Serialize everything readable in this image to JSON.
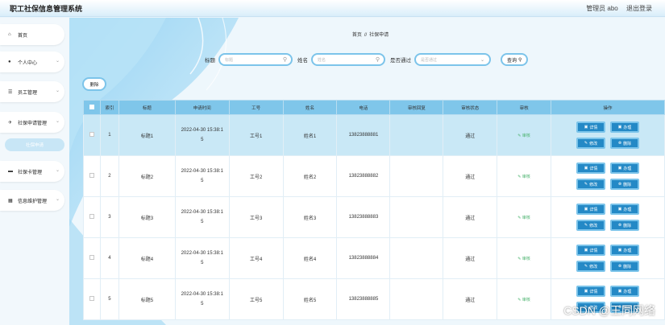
{
  "header": {
    "title": "职工社保信息管理系统",
    "user_label": "管理员 abo",
    "logout_label": "退出登录"
  },
  "sidebar": {
    "items": [
      {
        "label": "首页",
        "icon": "home-icon",
        "glyph": "⌂"
      },
      {
        "label": "个人中心",
        "icon": "user-icon",
        "glyph": "●"
      },
      {
        "label": "员工管理",
        "icon": "list-icon",
        "glyph": "☰"
      },
      {
        "label": "社保申请管理",
        "icon": "pin-icon",
        "glyph": "✈"
      },
      {
        "label": "社保卡管理",
        "icon": "card-icon",
        "glyph": "▬"
      },
      {
        "label": "信息维护管理",
        "icon": "grid-icon",
        "glyph": "▦"
      }
    ],
    "sub_item": "社保申请",
    "chevron": "⌄"
  },
  "breadcrumb": {
    "home": "首页",
    "sep": "//",
    "current": "社保申请"
  },
  "search": {
    "title_label": "标题",
    "title_placeholder": "标题",
    "name_label": "姓名",
    "name_placeholder": "姓名",
    "passed_label": "是否通过",
    "passed_placeholder": "是否通过",
    "query_label": "查询"
  },
  "toolbar": {
    "delete_label": "删除"
  },
  "table": {
    "headers": [
      "索引",
      "标题",
      "申请时间",
      "工号",
      "姓名",
      "电话",
      "审核回复",
      "审核状态",
      "审核",
      "操作"
    ],
    "rows": [
      {
        "index": "1",
        "title": "标题1",
        "time_a": "2022-04-30 15:38:1",
        "time_b": "5",
        "no": "工号1",
        "name": "姓名1",
        "phone": "13823888881",
        "reply": "",
        "status": "通过",
        "audit": "审核"
      },
      {
        "index": "2",
        "title": "标题2",
        "time_a": "2022-04-30 15:38:1",
        "time_b": "5",
        "no": "工号2",
        "name": "姓名2",
        "phone": "13823888882",
        "reply": "",
        "status": "通过",
        "audit": "审核"
      },
      {
        "index": "3",
        "title": "标题3",
        "time_a": "2022-04-30 15:38:1",
        "time_b": "5",
        "no": "工号3",
        "name": "姓名3",
        "phone": "13823888883",
        "reply": "",
        "status": "通过",
        "audit": "审核"
      },
      {
        "index": "4",
        "title": "标题4",
        "time_a": "2022-04-30 15:38:1",
        "time_b": "5",
        "no": "工号4",
        "name": "姓名4",
        "phone": "13823888884",
        "reply": "",
        "status": "通过",
        "audit": "审核"
      },
      {
        "index": "5",
        "title": "标题5",
        "time_a": "2022-04-30 15:38:1",
        "time_b": "5",
        "no": "工号5",
        "name": "姓名5",
        "phone": "13823888885",
        "reply": "",
        "status": "通过",
        "audit": "审核"
      }
    ],
    "ops": {
      "detail": "详情",
      "handle": "办理",
      "edit": "修改",
      "delete": "删除"
    }
  },
  "watermark": "CSDN @王同网络",
  "colors": {
    "accent": "#7fc6ea",
    "button": "#2489c6",
    "highlight": "#c9e8f6",
    "audit": "#4bb36f"
  }
}
